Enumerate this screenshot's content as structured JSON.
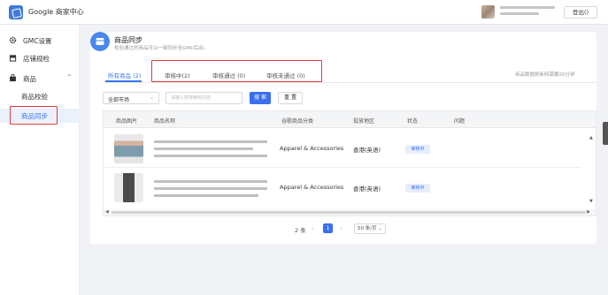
{
  "header": {
    "app_title": "Google 商家中心",
    "logout_label": "登出()"
  },
  "sidebar": {
    "items": [
      {
        "label": "GMC设置",
        "icon": "gear-icon"
      },
      {
        "label": "店铺规检",
        "icon": "store-icon"
      },
      {
        "label": "商品",
        "icon": "bag-icon",
        "chevron": "^"
      }
    ],
    "sub_items": [
      {
        "label": "商品校验"
      },
      {
        "label": "商品同步"
      }
    ]
  },
  "page": {
    "title": "商品同步",
    "subtitle": "校验通过的商品可以一键同步至GMC后台。"
  },
  "tabs": [
    {
      "label": "所有商品 (2)"
    },
    {
      "label": "审核中(2)"
    },
    {
      "label": "审核通过 (0)"
    },
    {
      "label": "审核未通过 (0)"
    }
  ],
  "sync_note": "商品数据刷新時需要20分钟",
  "filters": {
    "market_value": "全部市场",
    "search_placeholder": "请输入想搜索的内容",
    "search_label": "搜 索",
    "reset_label": "重 置"
  },
  "table": {
    "columns": [
      "商品图片",
      "商品名称",
      "谷歌商品分类",
      "投放地区",
      "状态",
      "问题"
    ],
    "rows": [
      {
        "category": "Apparel & Accessories",
        "region": "香港(英语)",
        "status": "审核中"
      },
      {
        "category": "Apparel & Accessories",
        "region": "香港(英语)",
        "status": "审核中"
      }
    ]
  },
  "pagination": {
    "total": "2 条",
    "current": "1",
    "page_size": "50 条/页 ⌄"
  },
  "colors": {
    "accent": "#3a6ff0",
    "highlight_outline": "#e23a3a"
  }
}
